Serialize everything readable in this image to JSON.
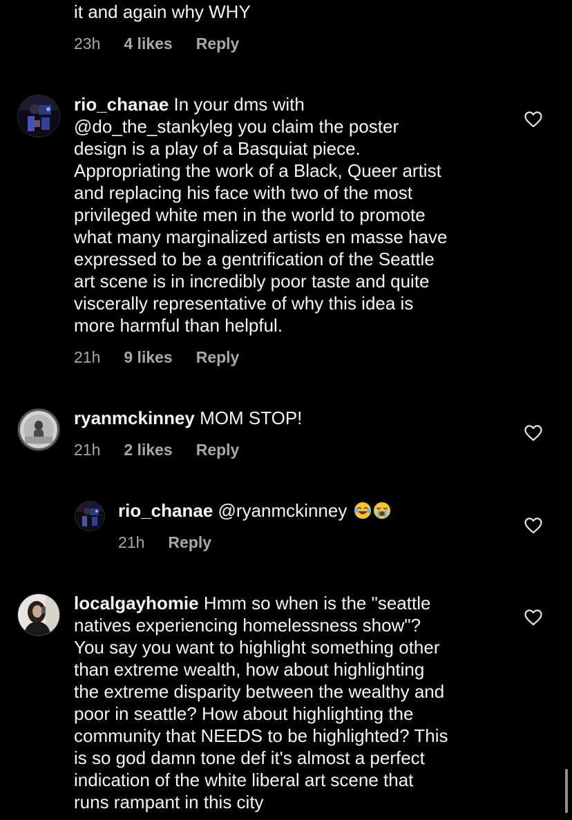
{
  "comments": [
    {
      "text": "it and again why WHY",
      "time": "23h",
      "likes": "4 likes",
      "reply": "Reply"
    },
    {
      "username": "rio_chanae",
      "text_before_mention": " In your dms with\n",
      "mention": "@do_the_stankyleg",
      "text": " you claim the poster\ndesign is a play of a Basquiat piece.\nAppropriating the work of a Black, Queer artist\nand replacing his face with two of the most\nprivileged white men in the world to promote\nwhat many marginalized artists en masse have\nexpressed to be a gentrification of the Seattle\nart scene is in incredibly poor taste and quite\nviscerally representative of why this idea is\nmore harmful than helpful.",
      "time": "21h",
      "likes": "9 likes",
      "reply": "Reply"
    },
    {
      "username": "ryanmckinney",
      "text": " MOM STOP!",
      "time": "21h",
      "likes": "2 likes",
      "reply": "Reply"
    },
    {
      "username": "rio_chanae",
      "mention": "@ryanmckinney",
      "emojis": [
        "laughing-emoji",
        "crying-emoji"
      ],
      "time": "21h",
      "reply": "Reply"
    },
    {
      "username": "localgayhomie",
      "text": " Hmm so when is the \"seattle\nnatives experiencing homelessness show\"?\nYou say you want to highlight something other\nthan extreme wealth, how about highlighting\nthe extreme disparity between the wealthy and\npoor in seattle? How about highlighting the\ncommunity that NEEDS to be highlighted? This\nis so god damn tone def it's almost a perfect\nindication of the white liberal art scene that\nruns rampant in this city"
    }
  ],
  "icons": {
    "like": "heart-outline-icon"
  },
  "colors": {
    "background": "#000000",
    "text": "#f5f5f5",
    "meta": "#a8a8a8"
  }
}
